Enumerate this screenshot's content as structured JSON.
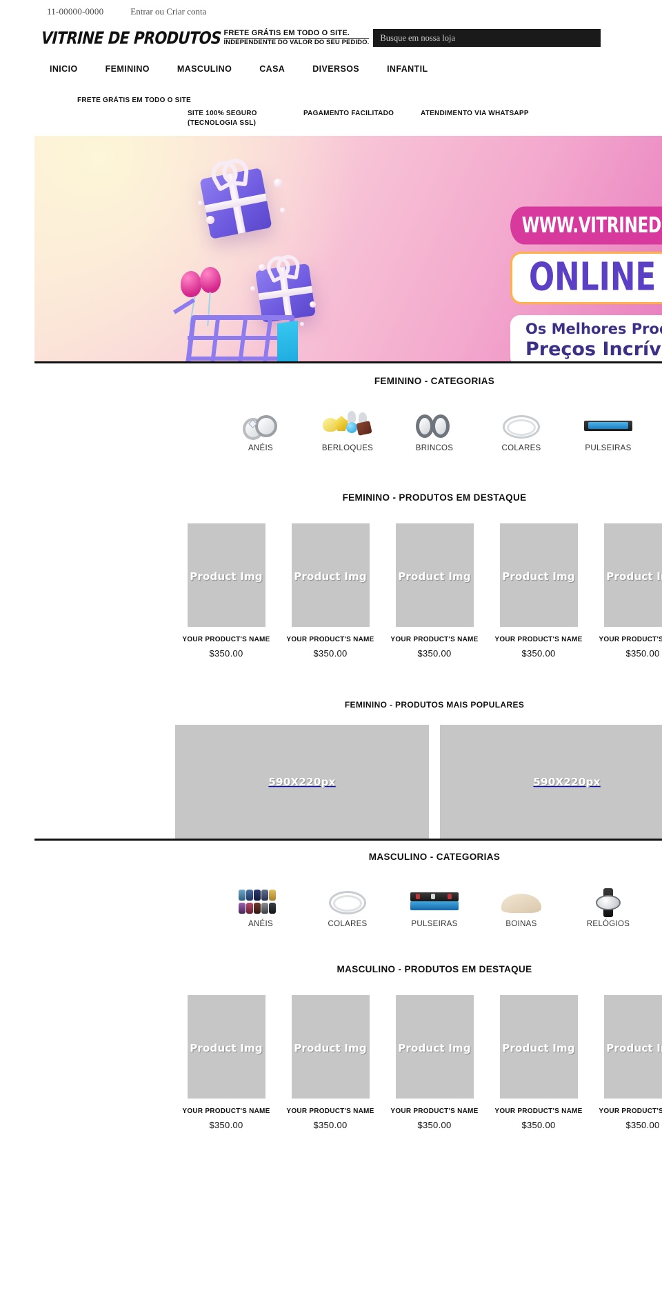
{
  "topbar": {
    "phone": "11-00000-0000",
    "account_text": "Entrar ou Criar conta"
  },
  "masthead": {
    "logo": "VITRINE DE PRODUTOS",
    "freight_line1": "FRETE GRÁTIS EM TODO O SITE.",
    "freight_line2": "INDEPENDENTE DO VALOR DO SEU PEDIDO.",
    "search_placeholder": "Busque em nossa loja"
  },
  "nav": {
    "items": [
      {
        "label": "INICIO"
      },
      {
        "label": "FEMININO"
      },
      {
        "label": "MASCULINO"
      },
      {
        "label": "CASA"
      },
      {
        "label": "DIVERSOS"
      },
      {
        "label": "INFANTIL"
      }
    ]
  },
  "info_strip": {
    "items": [
      "FRETE GRÁTIS EM TODO O SITE",
      "SITE 100% SEGURO (TECNOLOGIA SSL)",
      "PAGAMENTO FACILITADO",
      "ATENDIMENTO VIA WHATSAPP"
    ]
  },
  "hero": {
    "url_text": "WWW.VITRINEDEPRODUTOS.COM.BR",
    "headline": "ONLINE SHOP",
    "sub_line1": "Os Melhores Produtos com",
    "sub_line2": "Preços Incríveis",
    "colors": {
      "pink": "#d8399d",
      "purple": "#5b3fc4",
      "orange_border": "#ffb347"
    }
  },
  "sections": {
    "feminino_categorias": {
      "title": "FEMININO - CATEGORIAS",
      "items": [
        {
          "label": "ANÉIS",
          "icon": "rings-icon"
        },
        {
          "label": "BERLOQUES",
          "icon": "charms-icon"
        },
        {
          "label": "BRINCOS",
          "icon": "hoop-earrings-icon"
        },
        {
          "label": "COLARES",
          "icon": "necklace-icon"
        },
        {
          "label": "PULSEIRAS",
          "icon": "bracelet-icon"
        }
      ]
    },
    "feminino_produtos": {
      "title": "FEMININO - PRODUTOS EM DESTAQUE",
      "products": [
        {
          "image_label": "Product Img",
          "name": "YOUR PRODUCT'S NAME",
          "price": "$350.00"
        },
        {
          "image_label": "Product Img",
          "name": "YOUR PRODUCT'S NAME",
          "price": "$350.00"
        },
        {
          "image_label": "Product Img",
          "name": "YOUR PRODUCT'S NAME",
          "price": "$350.00"
        },
        {
          "image_label": "Product Img",
          "name": "YOUR PRODUCT'S NAME",
          "price": "$350.00"
        },
        {
          "image_label": "Product Img",
          "name": "YOUR PRODUCT'S NAME",
          "price": "$350.00"
        }
      ]
    },
    "feminino_populares": {
      "title": "FEMININO - PRODUTOS MAIS POPULARES",
      "banners": [
        {
          "label": "590X220px"
        },
        {
          "label": "590X220px"
        }
      ]
    },
    "masculino_categorias": {
      "title": "MASCULINO - CATEGORIAS",
      "items": [
        {
          "label": "ANÉIS",
          "icon": "beaded-rings-icon"
        },
        {
          "label": "COLARES",
          "icon": "necklace-icon"
        },
        {
          "label": "PULSEIRAS",
          "icon": "bracelet-icon"
        },
        {
          "label": "BOINAS",
          "icon": "beret-icon"
        },
        {
          "label": "RELÓGIOS",
          "icon": "watch-icon"
        }
      ]
    },
    "masculino_produtos": {
      "title": "MASCULINO - PRODUTOS EM DESTAQUE",
      "products": [
        {
          "image_label": "Product Img",
          "name": "YOUR PRODUCT'S NAME",
          "price": "$350.00"
        },
        {
          "image_label": "Product Img",
          "name": "YOUR PRODUCT'S NAME",
          "price": "$350.00"
        },
        {
          "image_label": "Product Img",
          "name": "YOUR PRODUCT'S NAME",
          "price": "$350.00"
        },
        {
          "image_label": "Product Img",
          "name": "YOUR PRODUCT'S NAME",
          "price": "$350.00"
        },
        {
          "image_label": "Product Img",
          "name": "YOUR PRODUCT'S NAME",
          "price": "$350.00"
        }
      ]
    }
  }
}
